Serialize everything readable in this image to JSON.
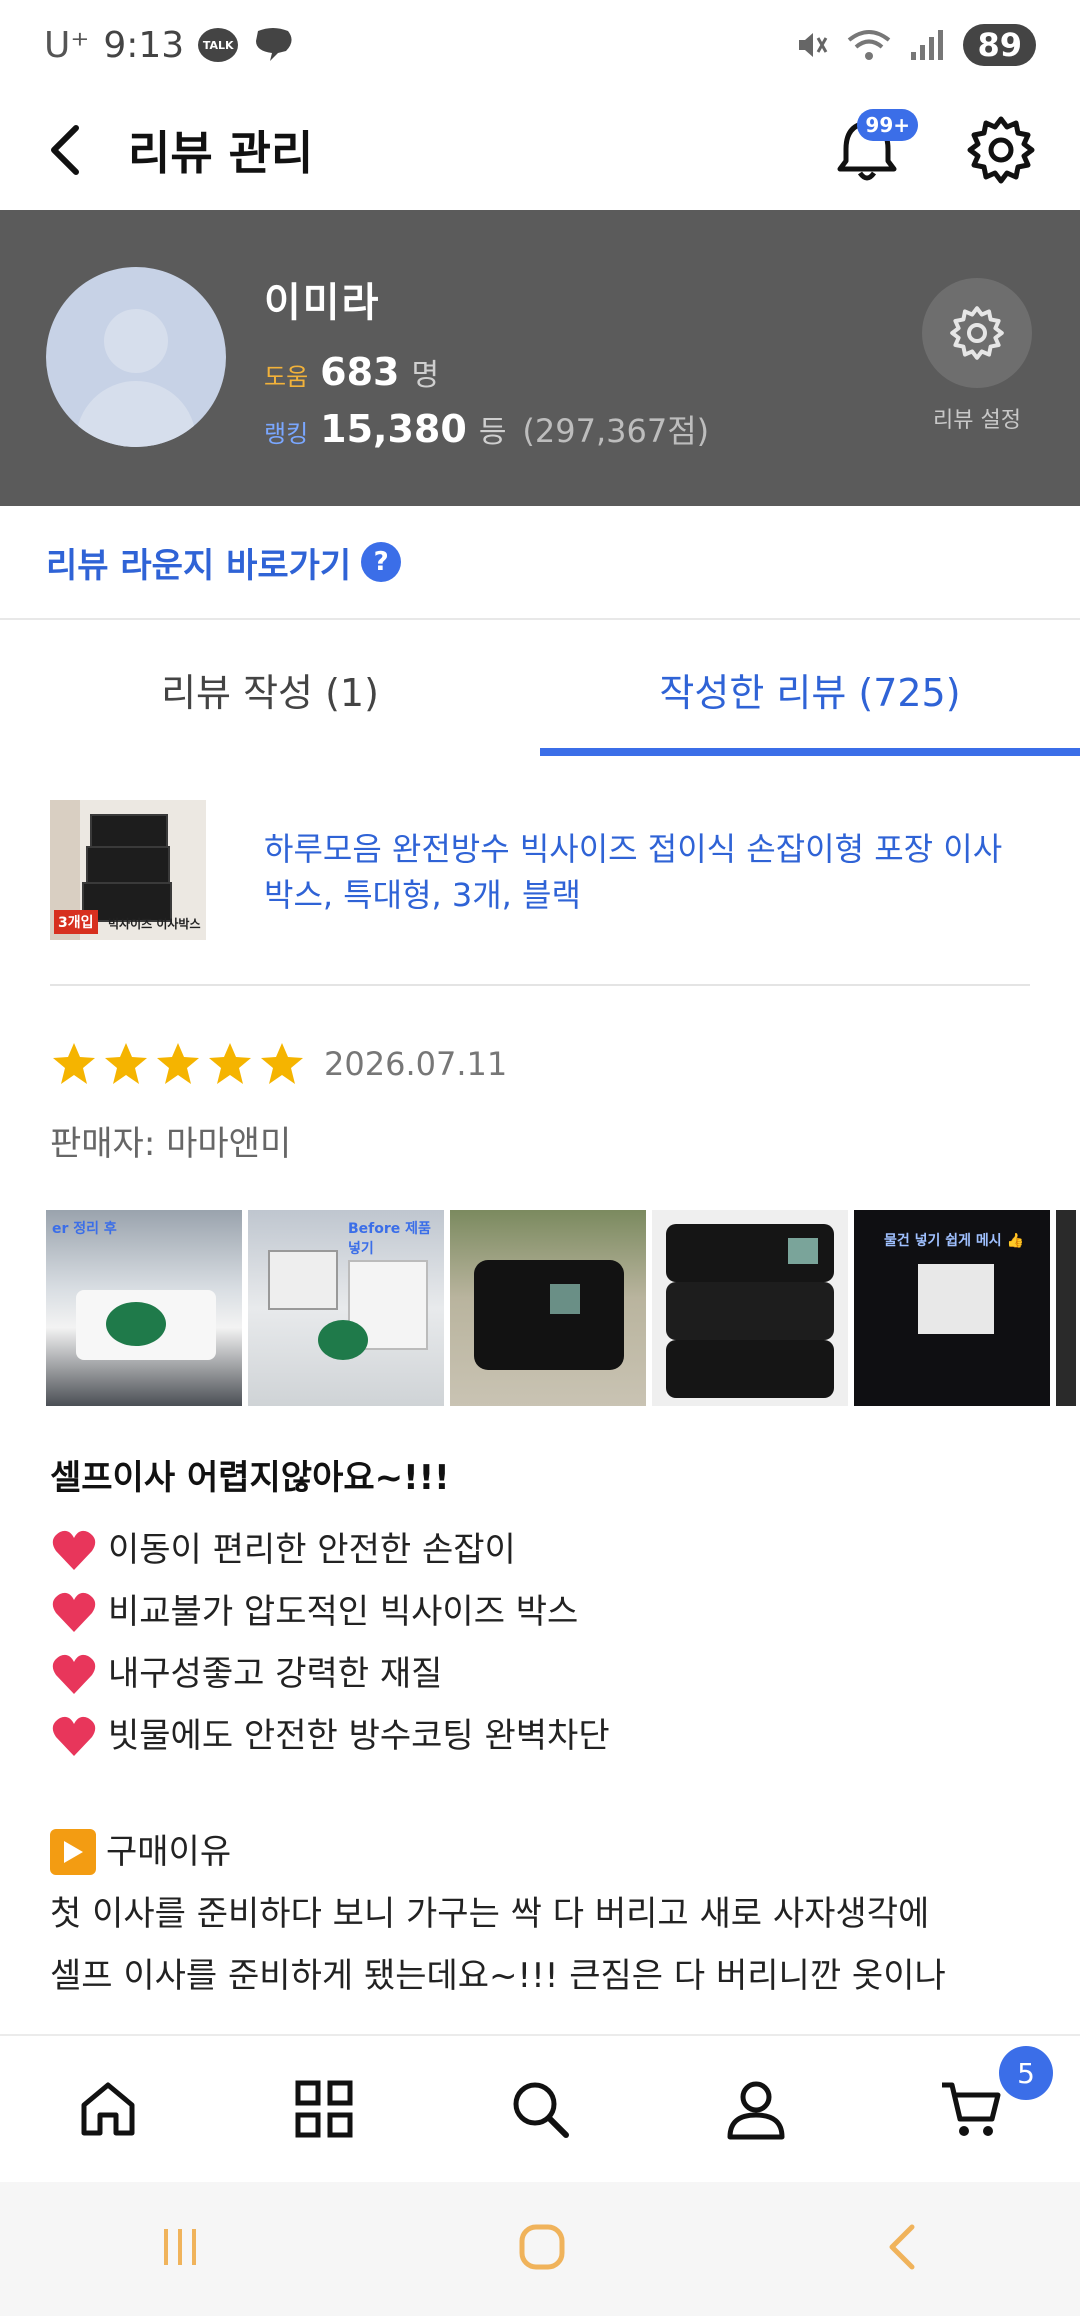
{
  "status_bar": {
    "carrier": "U⁺",
    "time": "9:13",
    "talk_badge": "TALK",
    "battery": "89"
  },
  "header": {
    "title": "리뷰 관리",
    "notification_badge": "99+"
  },
  "profile": {
    "name": "이미라",
    "help_label": "도움",
    "help_count": "683",
    "help_unit": "명",
    "rank_label": "랭킹",
    "rank_value": "15,380",
    "rank_unit": "등",
    "rank_points": "(297,367점)",
    "settings_label": "리뷰 설정"
  },
  "lounge": {
    "label": "리뷰 라운지 바로가기",
    "help_icon": "?"
  },
  "tabs": [
    {
      "label": "리뷰 작성 (1)",
      "active": false
    },
    {
      "label": "작성한 리뷰 (725)",
      "active": true
    }
  ],
  "product": {
    "thumb_tag": "3개입",
    "thumb_caption": "빅사이즈 이사박스",
    "title": "하루모음 완전방수 빅사이즈 접이식 손잡이형 포장 이사박스, 특대형, 3개, 블랙"
  },
  "review": {
    "rating": 5,
    "date": "2026.07.11",
    "seller": "판매자: 마마앤미",
    "photos": [
      {
        "label": "er 정리 후"
      },
      {
        "label": "Before 제품 넣기"
      },
      {
        "label": ""
      },
      {
        "label": ""
      },
      {
        "label": "물건 넣기 쉽게 메시 👍"
      }
    ],
    "title": "셀프이사 어렵지않아요~!!!",
    "bullets": [
      "이동이 편리한 안전한 손잡이",
      "비교불가 압도적인 빅사이즈 박스",
      "내구성좋고 강력한 재질",
      "빗물에도 안전한 방수코팅 완벽차단"
    ],
    "section_heading": "구매이유",
    "paragraph_lines": [
      "첫 이사를 준비하다 보니 가구는 싹 다 버리고 새로 사자생각에",
      "셀프 이사를 준비하게 됐는데요~!!! 큰짐은 다 버리니깐 옷이나"
    ]
  },
  "bottom_nav": {
    "items": [
      "home-icon",
      "category-icon",
      "search-icon",
      "user-icon",
      "cart-icon"
    ],
    "cart_count": "5"
  },
  "colors": {
    "accent": "#3b6ee8",
    "profile_bg": "#5b5b5b",
    "star": "#f5b400",
    "heart": "#e8365b"
  }
}
